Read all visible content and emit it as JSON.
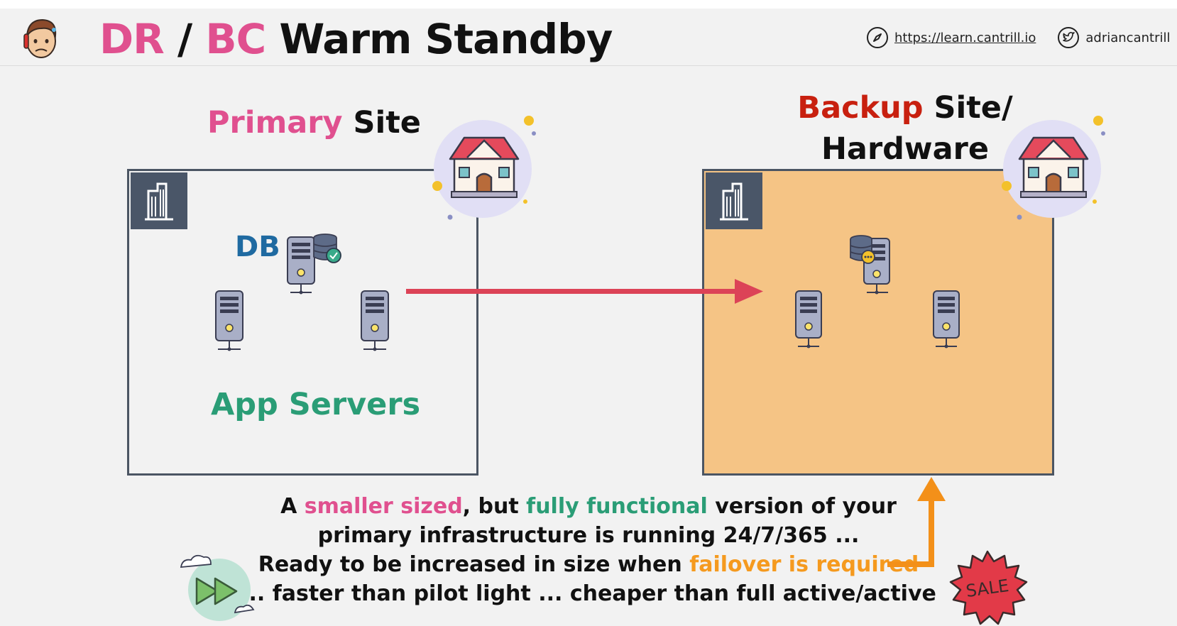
{
  "header": {
    "title_dr": "DR",
    "title_slash": " / ",
    "title_bc": "BC",
    "title_rest": " Warm Standby",
    "url": "https://learn.cantrill.io",
    "twitter": "adriancantrill"
  },
  "primary": {
    "label_colored": "Primary",
    "label_rest": " Site",
    "db_label": "DB",
    "app_label": "App Servers"
  },
  "backup": {
    "label_colored": "Backup",
    "label_rest": " Site/",
    "label_line2": "Hardware"
  },
  "caption": {
    "l1_a": "A ",
    "l1_b": "smaller sized",
    "l1_c": ", but ",
    "l1_d": "fully functional",
    "l1_e": " version of your",
    "l2": "primary infrastructure is running 24/7/365 ...",
    "l3_a": "Ready to be increased in size when ",
    "l3_b": "failover is required",
    "l4": "... faster than pilot light ... cheaper than full active/active"
  },
  "badge": {
    "sale": "SALE"
  },
  "colors": {
    "pink": "#e0508f",
    "green": "#2a9d76",
    "orange": "#f59a1f",
    "red": "#c8200f",
    "blue": "#1f6aa1",
    "backup_fill": "#f5c485",
    "arrow_red": "#dc4357"
  },
  "icons": [
    "avatar-icon",
    "compass-icon",
    "twitter-icon",
    "building-icon",
    "house-icon",
    "server-icon",
    "database-icon",
    "fast-forward-icon",
    "sale-badge-icon"
  ]
}
